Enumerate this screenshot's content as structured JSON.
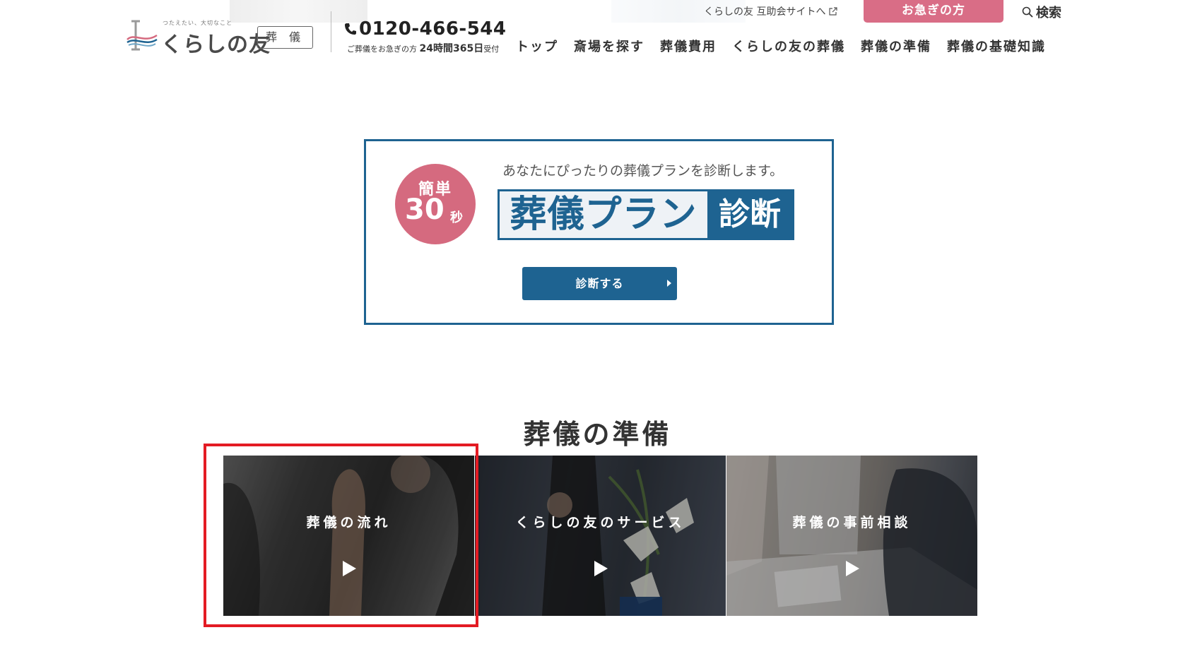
{
  "header": {
    "logo": {
      "tagline": "つたえたい、大切なこと",
      "text": "くらしの友"
    },
    "category_badge": "葬 儀",
    "phone": {
      "number": "0120-466-544",
      "note_prefix": "ご葬儀をお急ぎの方",
      "note_hours": "24時間365日",
      "note_suffix": "受付"
    },
    "mutual_site_link": "くらしの友 互助会サイトへ",
    "urgent_button": "お急ぎの方",
    "search_label": "検索",
    "nav": [
      "トップ",
      "斎場を探す",
      "葬儀費用",
      "くらしの友の葬儀",
      "葬儀の準備",
      "葬儀の基礎知識"
    ]
  },
  "diagnosis": {
    "circle_top": "簡単",
    "circle_number": "30",
    "circle_unit": "秒",
    "lead": "あなたにぴったりの葬儀プランを診断します。",
    "title_main": "葬儀プラン",
    "title_sub": "診断",
    "button_label": "診断する"
  },
  "preparation": {
    "title": "葬儀の準備",
    "cards": [
      {
        "label": "葬儀の流れ"
      },
      {
        "label": "くらしの友のサービス"
      },
      {
        "label": "葬儀の事前相談"
      }
    ],
    "highlighted_card": "葬儀の流れ"
  },
  "colors": {
    "brand_blue": "#1e6391",
    "accent_pink": "#d96d86",
    "highlight_red": "#e31b23"
  }
}
